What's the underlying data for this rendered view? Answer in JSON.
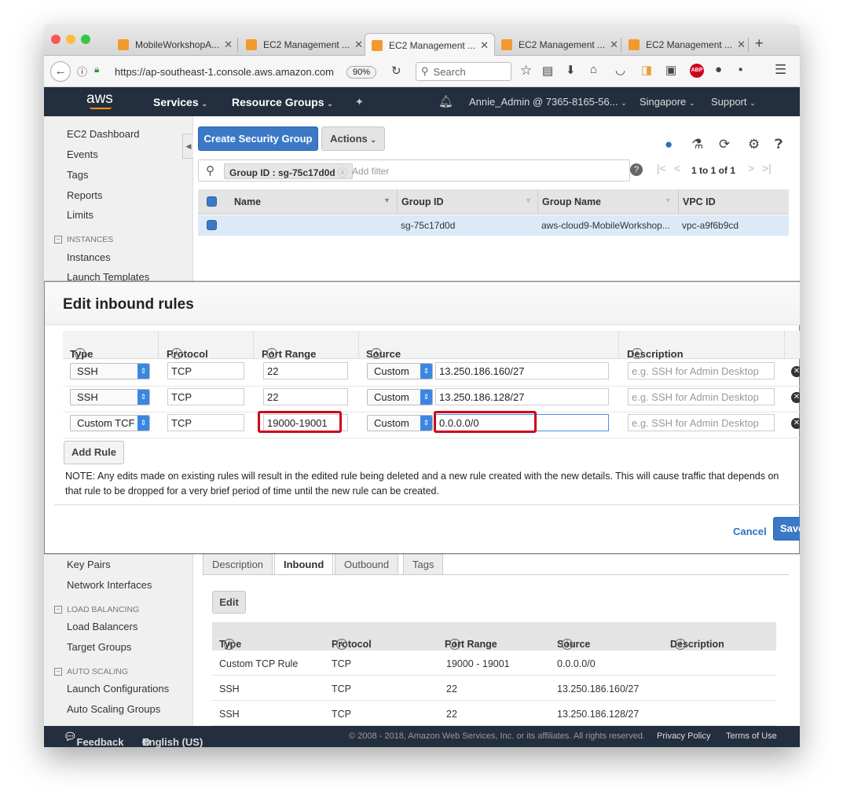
{
  "browser": {
    "tabs": [
      {
        "label": "MobileWorkshopA..."
      },
      {
        "label": "EC2 Management ..."
      },
      {
        "label": "EC2 Management ..."
      },
      {
        "label": "EC2 Management ..."
      },
      {
        "label": "EC2 Management ..."
      }
    ],
    "url": "https://ap-southeast-1.console.aws.amazon.com",
    "zoom": "90%",
    "search_placeholder": "Search"
  },
  "aws_nav": {
    "logo": "aws",
    "services": "Services",
    "resource_groups": "Resource Groups",
    "account": "Annie_Admin @ 7365-8165-56...",
    "region": "Singapore",
    "support": "Support"
  },
  "sidebar": {
    "items_top": [
      "EC2 Dashboard",
      "Events",
      "Tags",
      "Reports",
      "Limits"
    ],
    "instances_header": "INSTANCES",
    "instances_items": [
      "Instances",
      "Launch Templates"
    ],
    "items_mid": [
      "Key Pairs",
      "Network Interfaces"
    ],
    "lb_header": "LOAD BALANCING",
    "lb_items": [
      "Load Balancers",
      "Target Groups"
    ],
    "as_header": "AUTO SCALING",
    "as_items": [
      "Launch Configurations",
      "Auto Scaling Groups"
    ]
  },
  "toolbar": {
    "create_label": "Create Security Group",
    "actions_label": "Actions"
  },
  "filter": {
    "chip": "Group ID : sg-75c17d0d",
    "add_filter": "Add filter",
    "pagination": "1 to 1 of 1"
  },
  "grid": {
    "headers": [
      "Name",
      "Group ID",
      "Group Name",
      "VPC ID"
    ],
    "row": {
      "name": "",
      "group_id": "sg-75c17d0d",
      "group_name": "aws-cloud9-MobileWorkshop...",
      "vpc_id": "vpc-a9f6b9cd"
    }
  },
  "modal": {
    "title": "Edit inbound rules",
    "headers": {
      "type": "Type",
      "protocol": "Protocol",
      "port_range": "Port Range",
      "source": "Source",
      "description": "Description"
    },
    "rows": [
      {
        "type": "SSH",
        "protocol": "TCP",
        "port": "22",
        "source_type": "Custom",
        "source": "13.250.186.160/27",
        "desc_placeholder": "e.g. SSH for Admin Desktop"
      },
      {
        "type": "SSH",
        "protocol": "TCP",
        "port": "22",
        "source_type": "Custom",
        "source": "13.250.186.128/27",
        "desc_placeholder": "e.g. SSH for Admin Desktop"
      },
      {
        "type": "Custom TCF",
        "protocol": "TCP",
        "port": "19000-19001",
        "source_type": "Custom",
        "source": "0.0.0.0/0",
        "desc_placeholder": "e.g. SSH for Admin Desktop"
      }
    ],
    "add_rule": "Add Rule",
    "note": "NOTE: Any edits made on existing rules will result in the edited rule being deleted and a new rule created with the new details. This will cause traffic that depends on that rule to be dropped for a very brief period of time until the new rule can be created.",
    "cancel": "Cancel",
    "save": "Save"
  },
  "details": {
    "tabs": [
      "Description",
      "Inbound",
      "Outbound",
      "Tags"
    ],
    "edit": "Edit",
    "headers": {
      "type": "Type",
      "protocol": "Protocol",
      "port_range": "Port Range",
      "source": "Source",
      "description": "Description"
    },
    "rows": [
      {
        "type": "Custom TCP Rule",
        "protocol": "TCP",
        "port": "19000 - 19001",
        "source": "0.0.0.0/0"
      },
      {
        "type": "SSH",
        "protocol": "TCP",
        "port": "22",
        "source": "13.250.186.160/27"
      },
      {
        "type": "SSH",
        "protocol": "TCP",
        "port": "22",
        "source": "13.250.186.128/27"
      }
    ]
  },
  "footer": {
    "feedback": "Feedback",
    "language": "English (US)",
    "copyright": "© 2008 - 2018, Amazon Web Services, Inc. or its affiliates. All rights reserved.",
    "privacy": "Privacy Policy",
    "terms": "Terms of Use"
  },
  "colors": {
    "aws_nav": "#232f3e",
    "primary_button": "#3b79c7",
    "highlight_box": "#d0021b"
  }
}
